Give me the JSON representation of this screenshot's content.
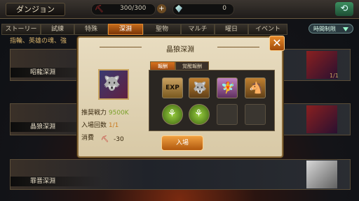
{
  "header": {
    "title": "ダンジョン",
    "stamina": "300/300",
    "gems": "0"
  },
  "tabs": [
    {
      "label": "ストーリー"
    },
    {
      "label": "試練"
    },
    {
      "label": "特殊"
    },
    {
      "label": "深淵"
    },
    {
      "label": "聖物"
    },
    {
      "label": "マルチ"
    },
    {
      "label": "曜日"
    },
    {
      "label": "イベント"
    }
  ],
  "time_filter": "時間制限",
  "hint": "指輪、英雄の魂、強",
  "rows": [
    {
      "label": "昭龍深淵"
    },
    {
      "label": "晶狼深淵"
    },
    {
      "label": "罪晋深淵"
    }
  ],
  "row_meta": "1/1",
  "modal": {
    "title": "晶狼深淵",
    "reward_tab_active": "報酬",
    "reward_tab_awakened": "覚醒報酬",
    "power_label": "推奨戦力",
    "power_value": "9500K",
    "entries_label": "入場回数",
    "entries_value": "1/1",
    "cost_label": "消費",
    "cost_value": "-30",
    "enter_button": "入場",
    "exp_label": "EXP"
  }
}
